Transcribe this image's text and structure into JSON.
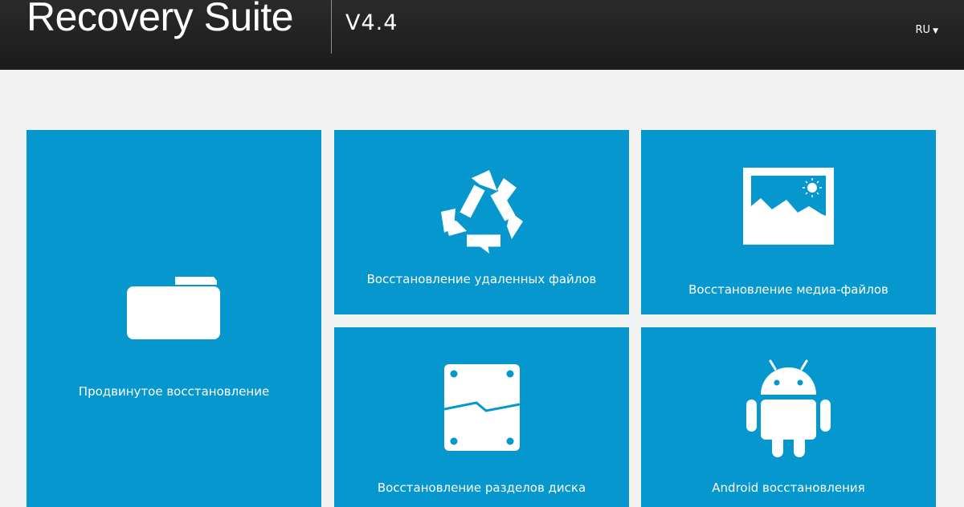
{
  "header": {
    "app_title": "Recovery Suite",
    "version": "V4.4",
    "language": "RU",
    "language_arrow": "▼"
  },
  "tiles": {
    "advanced": {
      "label": "Продвинутое восстановление",
      "icon": "folder-icon"
    },
    "deleted": {
      "label": "Восстановление удаленных файлов",
      "icon": "recycle-icon"
    },
    "media": {
      "label": "Восстановление медиа-файлов",
      "icon": "picture-icon"
    },
    "partition": {
      "label": "Восстановление разделов диска",
      "icon": "broken-disk-icon"
    },
    "android": {
      "label": "Android восстановления",
      "icon": "android-icon"
    }
  },
  "colors": {
    "header_background": "#1f1f1f",
    "page_background": "#f2f2f2",
    "tile_background": "#0597cd",
    "tile_foreground": "#ffffff"
  }
}
